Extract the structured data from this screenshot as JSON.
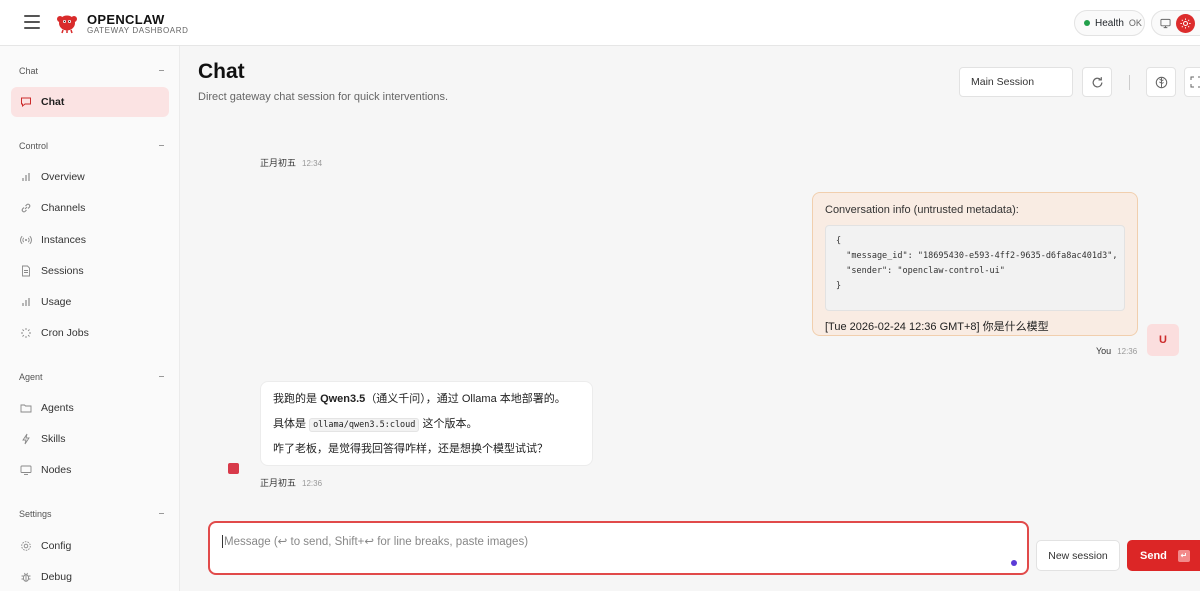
{
  "header": {
    "brand_title": "OPENCLAW",
    "brand_subtitle": "GATEWAY DASHBOARD",
    "health_label": "Health",
    "health_status": "OK",
    "status_color": "#22a04b",
    "accent_color": "#dc2626"
  },
  "sidebar": {
    "sections": [
      {
        "label": "Chat",
        "items": [
          {
            "label": "Chat",
            "icon": "chat-icon",
            "active": true
          }
        ]
      },
      {
        "label": "Control",
        "items": [
          {
            "label": "Overview",
            "icon": "bar-chart-icon"
          },
          {
            "label": "Channels",
            "icon": "link-icon"
          },
          {
            "label": "Instances",
            "icon": "radio-icon"
          },
          {
            "label": "Sessions",
            "icon": "document-icon"
          },
          {
            "label": "Usage",
            "icon": "bar-chart-icon"
          },
          {
            "label": "Cron Jobs",
            "icon": "loader-icon"
          }
        ]
      },
      {
        "label": "Agent",
        "items": [
          {
            "label": "Agents",
            "icon": "folder-icon"
          },
          {
            "label": "Skills",
            "icon": "bolt-icon"
          },
          {
            "label": "Nodes",
            "icon": "monitor-icon"
          }
        ]
      },
      {
        "label": "Settings",
        "items": [
          {
            "label": "Config",
            "icon": "gear-icon"
          },
          {
            "label": "Debug",
            "icon": "bug-icon"
          }
        ]
      }
    ]
  },
  "main": {
    "title": "Chat",
    "subtitle": "Direct gateway chat session for quick interventions.",
    "session_select": "Main Session"
  },
  "messages": {
    "first_meta": {
      "sender": "正月初五",
      "time": "12:34"
    },
    "user": {
      "title": "Conversation info (untrusted metadata):",
      "code": "{\n  \"message_id\": \"18695430-e593-4ff2-9635-d6fa8ac401d3\",\n  \"sender\": \"openclaw-control-ui\"\n}",
      "question": "[Tue 2026-02-24 12:36 GMT+8] 你是什么模型",
      "sender": "You",
      "time": "12:36",
      "avatar": "U"
    },
    "assistant": {
      "line1_pre": "我跑的是 ",
      "line1_bold": "Qwen3.5",
      "line1_post": "（通义千问），通过 Ollama 本地部署的。",
      "line2_pre": "具体是 ",
      "line2_code": "ollama/qwen3.5:cloud",
      "line2_post": " 这个版本。",
      "line3": "咋了老板，是觉得我回答得咋样，还是想换个模型试试？",
      "sender": "正月初五",
      "time": "12:36"
    }
  },
  "composer": {
    "placeholder": "Message (↩ to send, Shift+↩ for line breaks, paste images)",
    "new_session_label": "New session",
    "send_label": "Send",
    "send_kbd": "↵"
  }
}
